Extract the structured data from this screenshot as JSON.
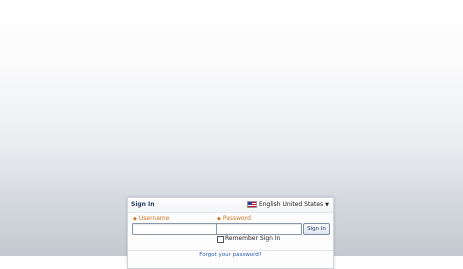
{
  "signin": {
    "title": "Sign In",
    "language": "English United States",
    "language_icon": "us-flag-icon",
    "username_label": "Username",
    "password_label": "Password",
    "username_value": "",
    "password_value": "",
    "signin_button": "Sign In",
    "remember_label": "Remember Sign In",
    "forgot_link": "Forgot your password?"
  },
  "colors": {
    "title": "#233a66",
    "field_label": "#d0721e",
    "link": "#2a5db0"
  }
}
